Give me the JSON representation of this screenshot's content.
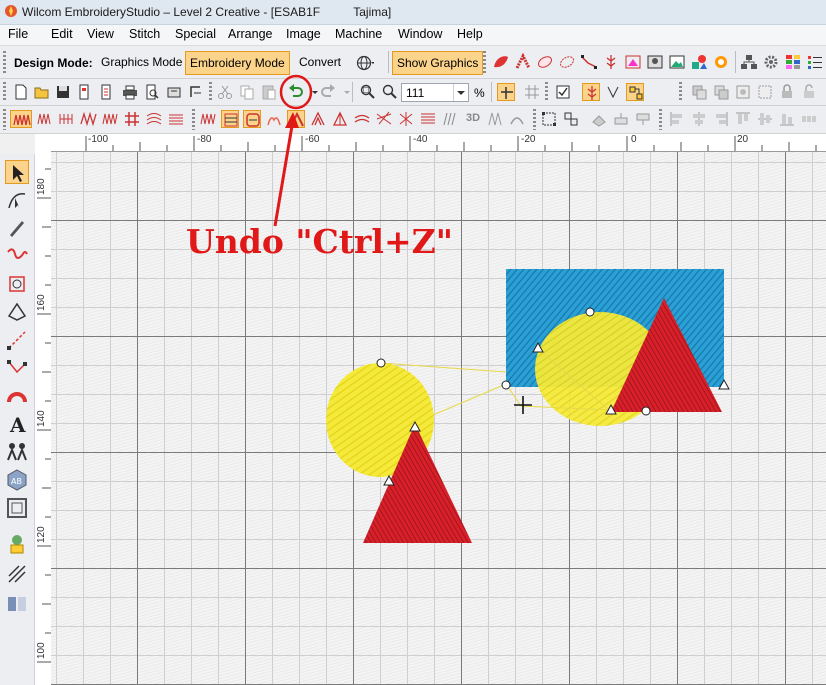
{
  "window": {
    "title": "Wilcom EmbroideryStudio – Level 2 Creative - [ESAB1F          Tajima]"
  },
  "menu": [
    "File",
    "Edit",
    "View",
    "Stitch",
    "Special",
    "Arrange",
    "Image",
    "Machine",
    "Window",
    "Help"
  ],
  "mode_toolbar": {
    "label": "Design Mode:",
    "graphics_mode": "Graphics Mode",
    "embroidery_mode": "Embroidery Mode",
    "convert": "Convert",
    "show_graphics": "Show Graphics",
    "active_mode": "Embroidery Mode"
  },
  "standard_toolbar": {
    "zoom_value": "111",
    "zoom_unit": "%"
  },
  "rulers": {
    "horizontal": [
      "-100",
      "-80",
      "-60",
      "-40",
      "-20",
      "0",
      "20"
    ],
    "vertical": [
      "180",
      "160",
      "140",
      "120",
      "100"
    ]
  },
  "annotation": {
    "text": "Undo \"Ctrl+Z\"",
    "color": "#e01818",
    "target": "undo-button"
  },
  "colors": {
    "accent": "#fbd38a",
    "fill_yellow": "#f5ea3a",
    "fill_red": "#d8202a",
    "fill_blue": "#2aa0d4"
  }
}
